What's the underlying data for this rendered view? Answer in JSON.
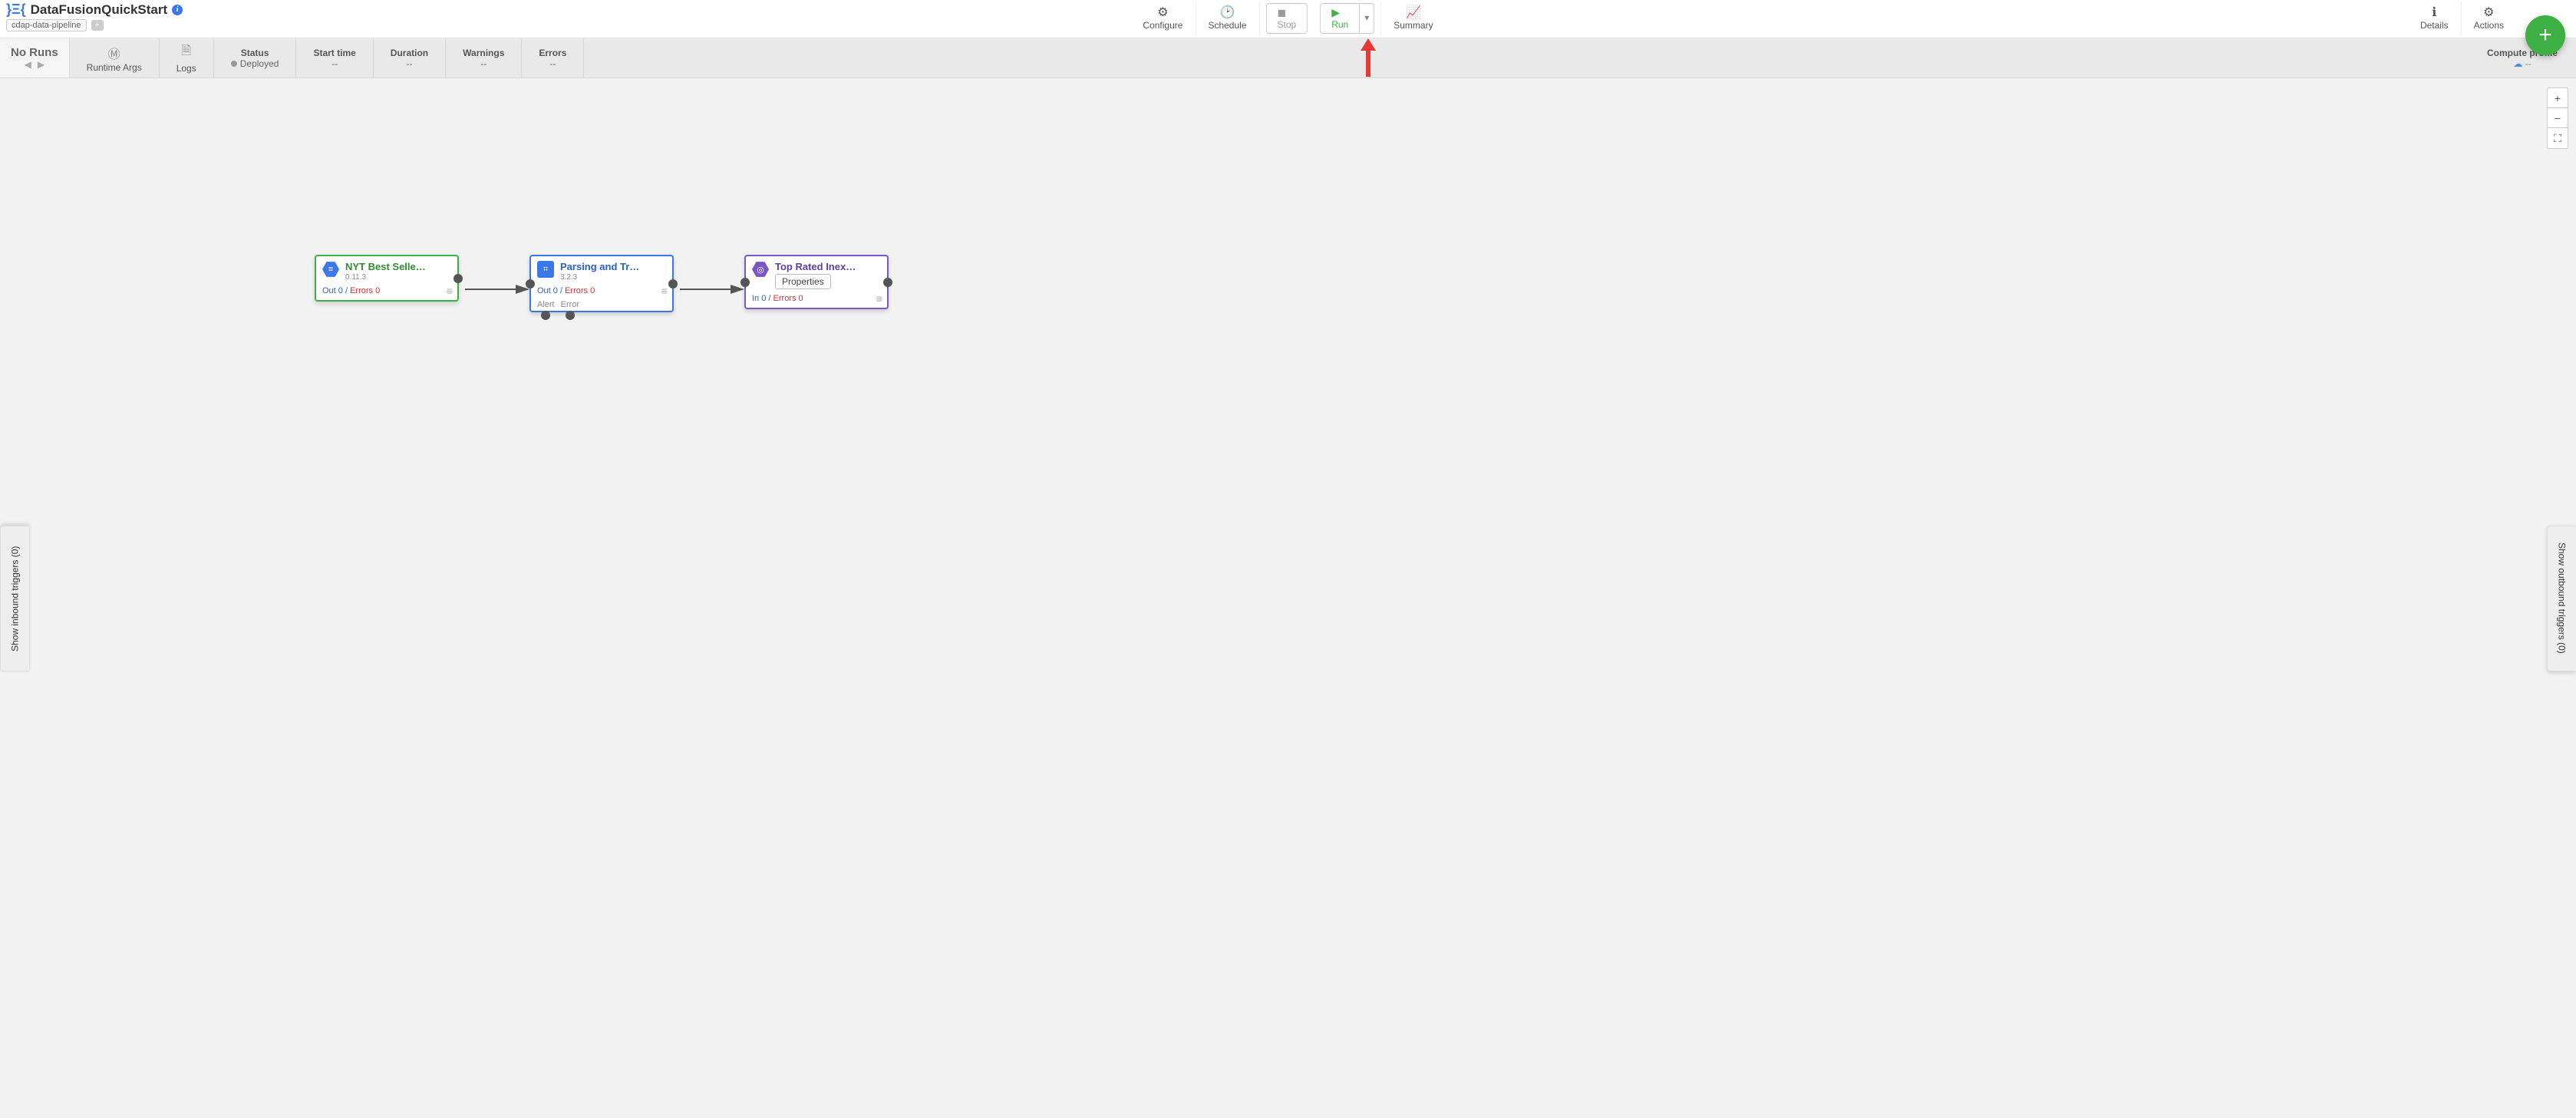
{
  "header": {
    "app_icon": "}Ξ{",
    "title": "DataFusionQuickStart",
    "tag": "cdap-data-pipeline",
    "plus": "+"
  },
  "tools": {
    "configure": "Configure",
    "schedule": "Schedule",
    "stop": "Stop",
    "run": "Run",
    "summary": "Summary",
    "details": "Details",
    "actions": "Actions"
  },
  "status_strip": {
    "noruns": "No Runs",
    "runtime_args": "Runtime Args",
    "logs": "Logs",
    "status_label": "Status",
    "status_value": "Deployed",
    "start_label": "Start time",
    "start_value": "--",
    "dur_label": "Duration",
    "dur_value": "--",
    "warn_label": "Warnings",
    "warn_value": "--",
    "err_label": "Errors",
    "err_value": "--",
    "compute_label": "Compute profile",
    "compute_value": "☁ --"
  },
  "side": {
    "inbound": "Show inbound triggers (0)",
    "outbound": "Show outbound triggers (0)"
  },
  "zoom": {
    "in": "+",
    "out": "−",
    "fit": "⛶"
  },
  "nodes": {
    "n1": {
      "title": "NYT Best Selle…",
      "ver": "0.11.3",
      "io": "Out 0",
      "sep": " / ",
      "err": "Errors 0"
    },
    "n2": {
      "title": "Parsing and Tr…",
      "ver": "3.2.3",
      "io": "Out 0",
      "sep": " / ",
      "err": "Errors 0",
      "alert": "Alert",
      "error": "Error"
    },
    "n3": {
      "title": "Top Rated Inex…",
      "props": "Properties",
      "io": "In 0",
      "sep": " / ",
      "err": "Errors 0"
    }
  },
  "fab": "+"
}
